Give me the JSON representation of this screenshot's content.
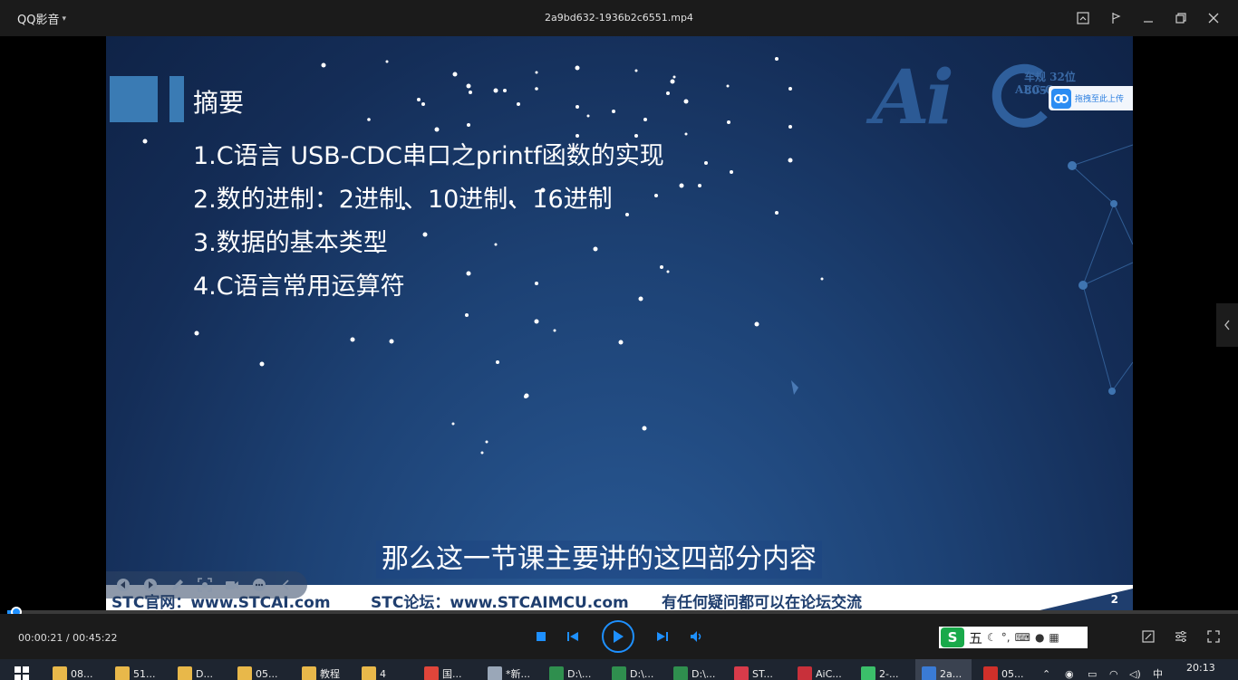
{
  "app": {
    "name": "QQ影音",
    "file_title": "2a9bd632-1936b2c6551.mp4"
  },
  "video": {
    "logo_big": "Ai",
    "logo_line1": "车规 32位 8051",
    "logo_line2": "AEC-Q",
    "upload_badge": "拖拽至此上传",
    "summary_title": "摘要",
    "summary_items": [
      "1.C语言 USB-CDC串口之printf函数的实现",
      "2.数的进制：2进制、10进制、16进制",
      "3.数据的基本类型",
      "4.C语言常用运算符"
    ],
    "subtitle": "那么这一节课主要讲的这四部分内容",
    "footer": {
      "site": "STC官网：www.STCAI.com",
      "forum": "STC论坛：www.STCAIMCU.com",
      "note": "有任何疑问都可以在论坛交流",
      "page": "2"
    }
  },
  "playback": {
    "timecode": "00:00:21 / 00:45:22",
    "progress_fraction": 0.0077
  },
  "ime": {
    "logo": "S",
    "mode": "五"
  },
  "taskbar": {
    "items": [
      {
        "label": "08...",
        "color": "#e8b84a"
      },
      {
        "label": "51...",
        "color": "#e8b84a"
      },
      {
        "label": "D...",
        "color": "#e8b84a"
      },
      {
        "label": "05...",
        "color": "#e8b84a"
      },
      {
        "label": "教程",
        "color": "#e8b84a"
      },
      {
        "label": "4",
        "color": "#e8b84a"
      },
      {
        "label": "国...",
        "color": "#e0453a"
      },
      {
        "label": "*新...",
        "color": "#9aa7b8"
      },
      {
        "label": "D:\\...",
        "color": "#2f8f4e"
      },
      {
        "label": "D:\\...",
        "color": "#2f8f4e"
      },
      {
        "label": "D:\\...",
        "color": "#2f8f4e"
      },
      {
        "label": "ST...",
        "color": "#d83b4a"
      },
      {
        "label": "AiC...",
        "color": "#c8303a"
      },
      {
        "label": "2-...",
        "color": "#3bbf6a"
      },
      {
        "label": "2a...",
        "color": "#3a7bd5"
      },
      {
        "label": "05...",
        "color": "#d0302a"
      }
    ],
    "clock": "20:13",
    "lang": "中"
  }
}
